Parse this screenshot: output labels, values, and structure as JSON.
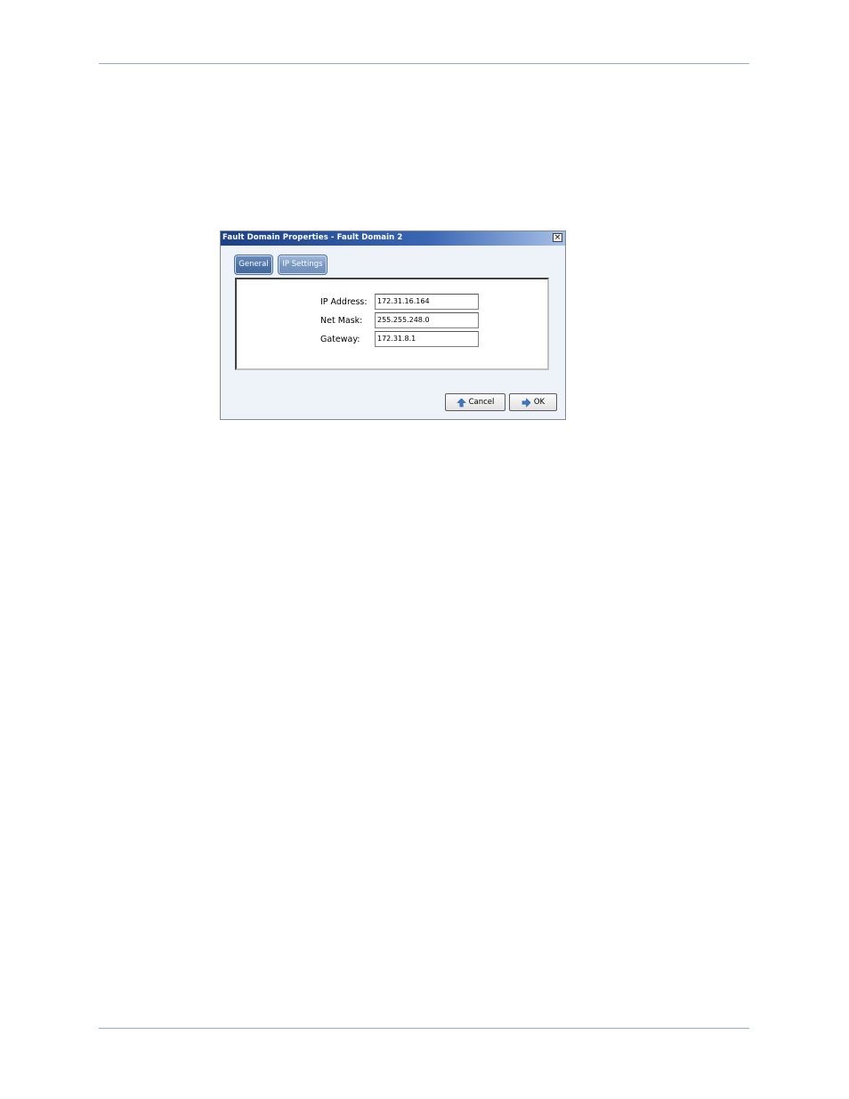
{
  "window": {
    "title": "Fault Domain Properties - Fault Domain 2",
    "close_label": "×"
  },
  "tabs": [
    {
      "label": "General",
      "selected": true
    },
    {
      "label": "IP Settings",
      "selected": false
    }
  ],
  "fields": {
    "ip_address": {
      "label": "IP Address:",
      "value": "172.31.16.164"
    },
    "net_mask": {
      "label": "Net Mask:",
      "value": "255.255.248.0"
    },
    "gateway": {
      "label": "Gateway:",
      "value": "172.31.8.1"
    }
  },
  "buttons": {
    "cancel": {
      "label": "Cancel",
      "icon": "up-arrow-icon"
    },
    "ok": {
      "label": "OK",
      "icon": "right-arrow-icon"
    }
  },
  "colors": {
    "titlebar": "#1c3f86",
    "tab": "#7a99c2",
    "rule": "#8fb0c4"
  }
}
